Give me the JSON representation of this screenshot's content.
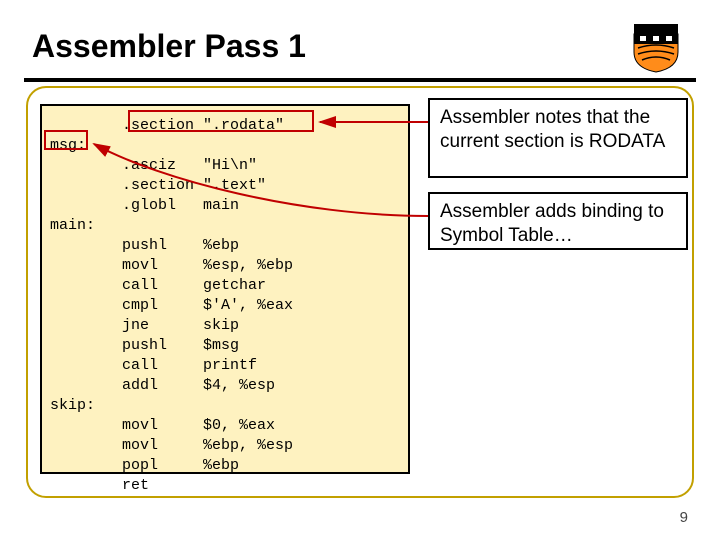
{
  "title": "Assembler Pass 1",
  "page_number": "9",
  "notes": {
    "n1": "Assembler notes that the current section is RODATA",
    "n2": "Assembler adds binding to Symbol Table…"
  },
  "code": {
    "l1": "        .section \".rodata\"",
    "l2": "msg:",
    "l3": "        .asciz   \"Hi\\n\"",
    "l4": "        .section \".text\"",
    "l5": "        .globl   main",
    "l6": "main:",
    "l7": "        pushl    %ebp",
    "l8": "        movl     %esp, %ebp",
    "l9": "        call     getchar",
    "l10": "        cmpl     $'A', %eax",
    "l11": "        jne      skip",
    "l12": "        pushl    $msg",
    "l13": "        call     printf",
    "l14": "        addl     $4, %esp",
    "l15": "skip:",
    "l16": "        movl     $0, %eax",
    "l17": "        movl     %ebp, %esp",
    "l18": "        popl     %ebp",
    "l19": "        ret"
  }
}
